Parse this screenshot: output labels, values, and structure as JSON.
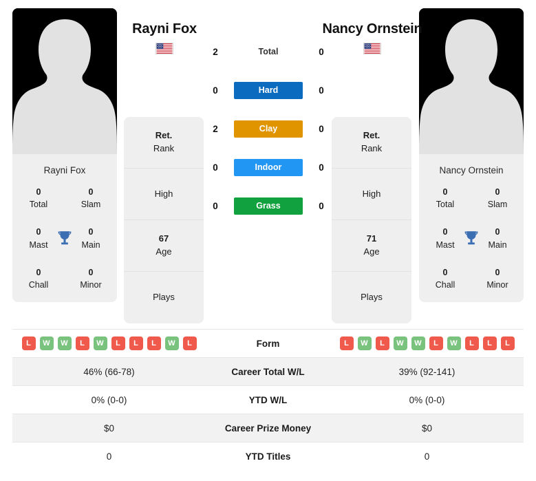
{
  "colors": {
    "hard": "#0b6cbf",
    "clay": "#e09400",
    "indoor": "#2196f3",
    "grass": "#12a13f",
    "win": "#79c37e",
    "loss": "#ef5a4c",
    "trophy": "#3c6eb4",
    "card_bg": "#efefef",
    "row_alt": "#f2f2f2"
  },
  "players": {
    "left": {
      "name": "Rayni Fox",
      "country_flag": "us-flag-icon",
      "photo": "player-silhouette",
      "card_name": "Rayni Fox",
      "honours": [
        {
          "value": "0",
          "label": "Total"
        },
        {
          "value": "0",
          "label": "Slam"
        },
        {
          "value": "0",
          "label": "Mast"
        },
        {
          "value": "0",
          "label": "Main"
        },
        {
          "value": "0",
          "label": "Chall"
        },
        {
          "value": "0",
          "label": "Minor"
        }
      ],
      "info": [
        {
          "value": "Ret.",
          "label": "Rank"
        },
        {
          "value": "",
          "label": "High"
        },
        {
          "value": "67",
          "label": "Age"
        },
        {
          "value": "",
          "label": "Plays"
        }
      ],
      "form": [
        "L",
        "W",
        "W",
        "L",
        "W",
        "L",
        "L",
        "L",
        "W",
        "L"
      ]
    },
    "right": {
      "name": "Nancy Ornstein",
      "country_flag": "us-flag-icon",
      "photo": "player-silhouette",
      "card_name": "Nancy Ornstein",
      "honours": [
        {
          "value": "0",
          "label": "Total"
        },
        {
          "value": "0",
          "label": "Slam"
        },
        {
          "value": "0",
          "label": "Mast"
        },
        {
          "value": "0",
          "label": "Main"
        },
        {
          "value": "0",
          "label": "Chall"
        },
        {
          "value": "0",
          "label": "Minor"
        }
      ],
      "info": [
        {
          "value": "Ret.",
          "label": "Rank"
        },
        {
          "value": "",
          "label": "High"
        },
        {
          "value": "71",
          "label": "Age"
        },
        {
          "value": "",
          "label": "Plays"
        }
      ],
      "form": [
        "L",
        "W",
        "L",
        "W",
        "W",
        "L",
        "W",
        "L",
        "L",
        "L"
      ]
    }
  },
  "h2h": [
    {
      "left": "2",
      "label": "Total",
      "right": "0",
      "style": "plain",
      "color": ""
    },
    {
      "left": "0",
      "label": "Hard",
      "right": "0",
      "style": "badge",
      "color": "#0b6cbf"
    },
    {
      "left": "2",
      "label": "Clay",
      "right": "0",
      "style": "badge",
      "color": "#e09400"
    },
    {
      "left": "0",
      "label": "Indoor",
      "right": "0",
      "style": "badge",
      "color": "#2196f3"
    },
    {
      "left": "0",
      "label": "Grass",
      "right": "0",
      "style": "badge",
      "color": "#12a13f"
    }
  ],
  "stats_rows": [
    {
      "label": "Form",
      "left": "",
      "right": "",
      "type": "form",
      "shade": "plain"
    },
    {
      "label": "Career Total W/L",
      "left": "46% (66-78)",
      "right": "39% (92-141)",
      "type": "text",
      "shade": "alt"
    },
    {
      "label": "YTD W/L",
      "left": "0% (0-0)",
      "right": "0% (0-0)",
      "type": "text",
      "shade": "plain"
    },
    {
      "label": "Career Prize Money",
      "left": "$0",
      "right": "$0",
      "type": "text",
      "shade": "alt"
    },
    {
      "label": "YTD Titles",
      "left": "0",
      "right": "0",
      "type": "text",
      "shade": "plain"
    }
  ]
}
